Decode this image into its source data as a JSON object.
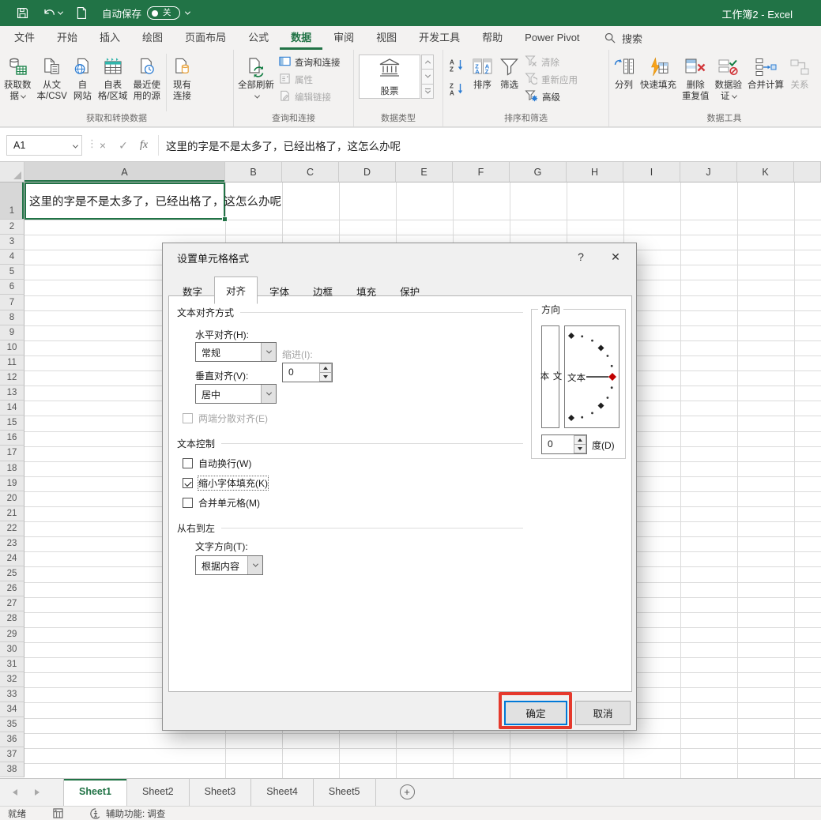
{
  "titlebar": {
    "autosave_label": "自动保存",
    "autosave_state": "关",
    "title": "工作簿2 - Excel"
  },
  "menu": {
    "tabs": [
      {
        "label": "文件",
        "active": false
      },
      {
        "label": "开始",
        "active": false
      },
      {
        "label": "插入",
        "active": false
      },
      {
        "label": "绘图",
        "active": false
      },
      {
        "label": "页面布局",
        "active": false
      },
      {
        "label": "公式",
        "active": false
      },
      {
        "label": "数据",
        "active": true
      },
      {
        "label": "审阅",
        "active": false
      },
      {
        "label": "视图",
        "active": false
      },
      {
        "label": "开发工具",
        "active": false
      },
      {
        "label": "帮助",
        "active": false
      },
      {
        "label": "Power Pivot",
        "active": false
      }
    ],
    "search_label": "搜索"
  },
  "ribbon": {
    "groups": [
      {
        "id": "get-transform-data",
        "label": "获取和转换数据",
        "items": [
          {
            "type": "big",
            "name": "get-data",
            "icon": "get-data",
            "lines": [
              "获取数",
              "据"
            ],
            "caret": true
          },
          {
            "type": "big",
            "name": "from-text-csv",
            "icon": "text-csv",
            "lines": [
              "从文",
              "本/CSV"
            ]
          },
          {
            "type": "big",
            "name": "from-web",
            "icon": "web",
            "lines": [
              "自",
              "网站"
            ]
          },
          {
            "type": "big",
            "name": "from-table-range",
            "icon": "table-range",
            "lines": [
              "自表",
              "格/区域"
            ]
          },
          {
            "type": "big",
            "name": "recent-sources",
            "icon": "recent-sources",
            "lines": [
              "最近使",
              "用的源"
            ]
          },
          {
            "type": "sep"
          },
          {
            "type": "big",
            "name": "existing-connections",
            "icon": "existing-connections",
            "lines": [
              "现有",
              "连接"
            ]
          }
        ]
      },
      {
        "id": "queries-connections",
        "label": "查询和连接",
        "items": [
          {
            "type": "big",
            "name": "refresh-all",
            "icon": "refresh-all",
            "lines": [
              "全部刷新",
              ""
            ],
            "caret": true
          },
          {
            "type": "smallcol",
            "buttons": [
              {
                "name": "queries-connections",
                "icon": "queries-connections",
                "label": "查询和连接",
                "disabled": false
              },
              {
                "name": "properties",
                "icon": "properties",
                "label": "属性",
                "disabled": true
              },
              {
                "name": "edit-links",
                "icon": "edit-links",
                "label": "编辑链接",
                "disabled": true
              }
            ]
          }
        ]
      },
      {
        "id": "data-types",
        "label": "数据类型",
        "items": [
          {
            "type": "gallery",
            "entries": [
              {
                "name": "stocks",
                "icon": "stocks",
                "label": "股票"
              }
            ]
          }
        ]
      },
      {
        "id": "sort-filter",
        "label": "排序和筛选",
        "items": [
          {
            "type": "stack",
            "buttons": [
              {
                "name": "sort-ascending",
                "icon": "sort-az"
              },
              {
                "name": "sort-descending",
                "icon": "sort-za"
              }
            ]
          },
          {
            "type": "big",
            "name": "sort",
            "icon": "sort",
            "lines": [
              "排序"
            ]
          },
          {
            "type": "big",
            "name": "filter",
            "icon": "filter",
            "lines": [
              "筛选"
            ]
          },
          {
            "type": "smallcol",
            "buttons": [
              {
                "name": "clear-filter",
                "icon": "clear-filter",
                "label": "清除",
                "disabled": true
              },
              {
                "name": "reapply-filter",
                "icon": "reapply-filter",
                "label": "重新应用",
                "disabled": true
              },
              {
                "name": "advanced-filter",
                "icon": "advanced-filter",
                "label": "高级",
                "disabled": false
              }
            ]
          }
        ]
      },
      {
        "id": "data-tools",
        "label": "数据工具",
        "items": [
          {
            "type": "big",
            "name": "text-to-columns",
            "icon": "text-to-columns",
            "lines": [
              "分列"
            ]
          },
          {
            "type": "big",
            "name": "flash-fill",
            "icon": "flash-fill",
            "lines": [
              "快速填充"
            ]
          },
          {
            "type": "big",
            "name": "remove-duplicates",
            "icon": "remove-duplicates",
            "lines": [
              "删除",
              "重复值"
            ]
          },
          {
            "type": "big",
            "name": "data-validation",
            "icon": "data-validation",
            "lines": [
              "数据验",
              "证"
            ],
            "caret": true
          },
          {
            "type": "big",
            "name": "consolidate",
            "icon": "consolidate",
            "lines": [
              "合并计算"
            ]
          },
          {
            "type": "big",
            "name": "relationships",
            "icon": "relationships",
            "lines": [
              "关系"
            ],
            "disabled": true
          }
        ]
      }
    ]
  },
  "formula_bar": {
    "name_box": "A1",
    "cancel": "×",
    "enter": "✓",
    "fx": "fx",
    "value": "这里的字是不是太多了，已经出格了，这怎么办呢"
  },
  "grid": {
    "columns": [
      "A",
      "B",
      "C",
      "D",
      "E",
      "F",
      "G",
      "H",
      "I",
      "J",
      "K"
    ],
    "selected_column": "A",
    "row_count": 38,
    "selected_row": 1,
    "a1_text": "这里的字是不是太多了，已经出格了，这怎么办呢"
  },
  "dialog": {
    "title": "设置单元格格式",
    "help_label": "?",
    "close_label": "✕",
    "tabs": [
      {
        "label": "数字",
        "active": false
      },
      {
        "label": "对齐",
        "active": true
      },
      {
        "label": "字体",
        "active": false
      },
      {
        "label": "边框",
        "active": false
      },
      {
        "label": "填充",
        "active": false
      },
      {
        "label": "保护",
        "active": false
      }
    ],
    "text_alignment": {
      "heading": "文本对齐方式",
      "horizontal_label": "水平对齐(H):",
      "horizontal_value": "常规",
      "indent_label": "缩进(I):",
      "indent_value": "0",
      "vertical_label": "垂直对齐(V):",
      "vertical_value": "居中",
      "justify_distributed_label": "两端分散对齐(E)",
      "justify_distributed_checked": false
    },
    "text_control": {
      "heading": "文本控制",
      "wrap_label": "自动换行(W)",
      "wrap_checked": false,
      "shrink_label": "缩小字体填充(K)",
      "shrink_checked": true,
      "merge_label": "合并单元格(M)",
      "merge_checked": false
    },
    "right_to_left": {
      "heading": "从右到左",
      "direction_label": "文字方向(T):",
      "direction_value": "根据内容"
    },
    "orientation": {
      "heading": "方向",
      "vertical_text": "文本",
      "dial_text": "文本",
      "degrees_value": "0",
      "degrees_label": "度(D)"
    },
    "ok_label": "确定",
    "cancel_label": "取消",
    "annotation_color": "#e5392c"
  },
  "sheet_bar": {
    "tabs": [
      {
        "label": "Sheet1",
        "active": true
      },
      {
        "label": "Sheet2",
        "active": false
      },
      {
        "label": "Sheet3",
        "active": false
      },
      {
        "label": "Sheet4",
        "active": false
      },
      {
        "label": "Sheet5",
        "active": false
      }
    ],
    "add_label": "+"
  },
  "status_bar": {
    "ready": "就绪",
    "accessibility": "辅助功能: 调查"
  }
}
